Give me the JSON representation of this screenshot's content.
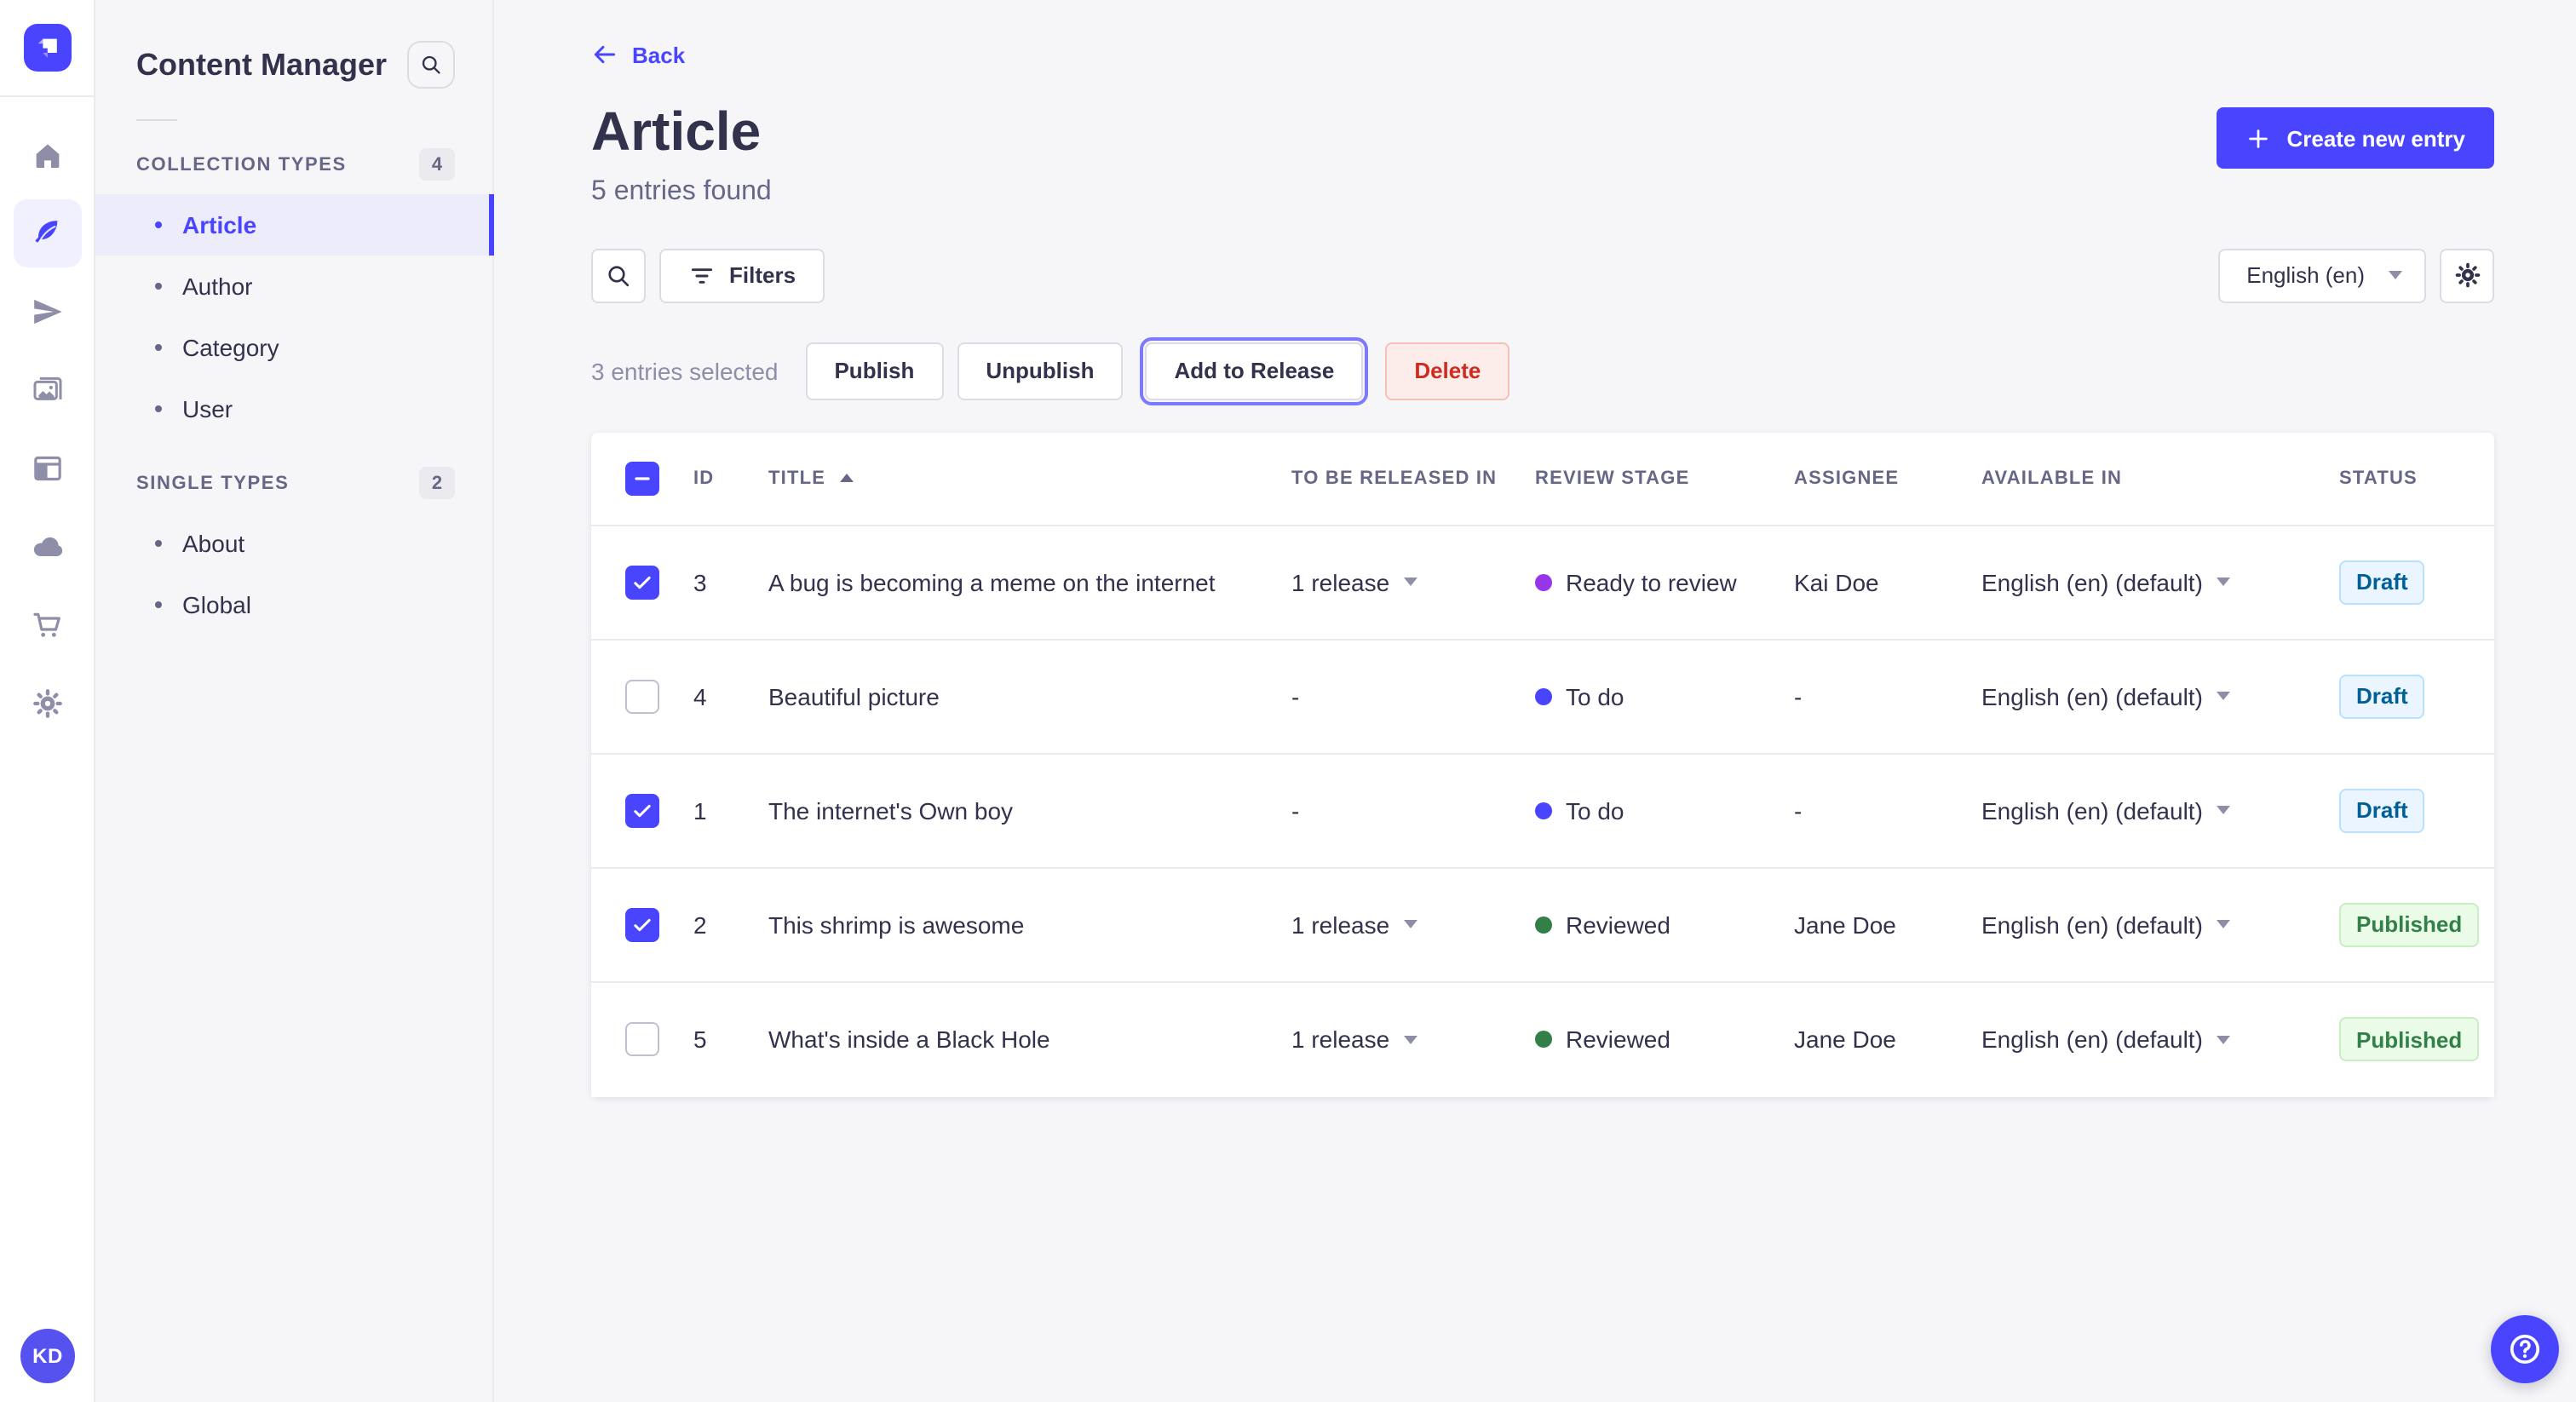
{
  "colors": {
    "accent": "#4945ff",
    "stage_ready_to_review": "#9736e8",
    "stage_to_do": "#4945ff",
    "stage_reviewed": "#328048",
    "draft_badge_text": "#006096",
    "published_badge_text": "#328048",
    "delete_text": "#d02b20"
  },
  "primary_nav": {
    "items": [
      {
        "id": "home",
        "icon": "home-icon",
        "active": false
      },
      {
        "id": "content-manager",
        "icon": "feather-icon",
        "active": true
      },
      {
        "id": "releases",
        "icon": "paper-plane-icon",
        "active": false
      },
      {
        "id": "media-library",
        "icon": "images-icon",
        "active": false
      },
      {
        "id": "content-type-builder",
        "icon": "layout-icon",
        "active": false
      },
      {
        "id": "cloud",
        "icon": "cloud-icon",
        "active": false
      },
      {
        "id": "marketplace",
        "icon": "cart-icon",
        "active": false
      },
      {
        "id": "settings",
        "icon": "gear-icon",
        "active": false
      }
    ],
    "avatar_initials": "KD"
  },
  "subnav": {
    "title": "Content Manager",
    "search_icon": "search-icon",
    "sections": [
      {
        "label": "COLLECTION TYPES",
        "count": "4",
        "items": [
          {
            "label": "Article",
            "active": true
          },
          {
            "label": "Author",
            "active": false
          },
          {
            "label": "Category",
            "active": false
          },
          {
            "label": "User",
            "active": false
          }
        ]
      },
      {
        "label": "SINGLE TYPES",
        "count": "2",
        "items": [
          {
            "label": "About",
            "active": false
          },
          {
            "label": "Global",
            "active": false
          }
        ]
      }
    ]
  },
  "header": {
    "back_label": "Back",
    "title": "Article",
    "subtitle": "5 entries found",
    "create_button_label": "Create new entry"
  },
  "toolbar": {
    "filters_label": "Filters",
    "locale_value": "English (en)"
  },
  "selection_bar": {
    "selected_text": "3 entries selected",
    "publish_label": "Publish",
    "unpublish_label": "Unpublish",
    "add_to_release_label": "Add to Release",
    "delete_label": "Delete"
  },
  "table": {
    "columns": [
      "ID",
      "TITLE",
      "TO BE RELEASED IN",
      "REVIEW STAGE",
      "ASSIGNEE",
      "AVAILABLE IN",
      "STATUS"
    ],
    "sort": {
      "column": "TITLE",
      "direction": "ascending"
    },
    "rows": [
      {
        "selected": true,
        "id": "3",
        "title": "A bug is becoming a meme on the internet",
        "to_be_released_in": "1 release",
        "review_stage": "Ready to review",
        "stage_color": "#9736e8",
        "assignee": "Kai Doe",
        "available_in": "English (en) (default)",
        "status": "Draft"
      },
      {
        "selected": false,
        "id": "4",
        "title": "Beautiful picture",
        "to_be_released_in": "-",
        "review_stage": "To do",
        "stage_color": "#4945ff",
        "assignee": "-",
        "available_in": "English (en) (default)",
        "status": "Draft"
      },
      {
        "selected": true,
        "id": "1",
        "title": "The internet's Own boy",
        "to_be_released_in": "-",
        "review_stage": "To do",
        "stage_color": "#4945ff",
        "assignee": "-",
        "available_in": "English (en) (default)",
        "status": "Draft"
      },
      {
        "selected": true,
        "id": "2",
        "title": "This shrimp is awesome",
        "to_be_released_in": "1 release",
        "review_stage": "Reviewed",
        "stage_color": "#328048",
        "assignee": "Jane Doe",
        "available_in": "English (en) (default)",
        "status": "Published"
      },
      {
        "selected": false,
        "id": "5",
        "title": "What's inside a Black Hole",
        "to_be_released_in": "1 release",
        "review_stage": "Reviewed",
        "stage_color": "#328048",
        "assignee": "Jane Doe",
        "available_in": "English (en) (default)",
        "status": "Published"
      }
    ]
  },
  "help": {
    "icon": "question-circle-icon"
  }
}
